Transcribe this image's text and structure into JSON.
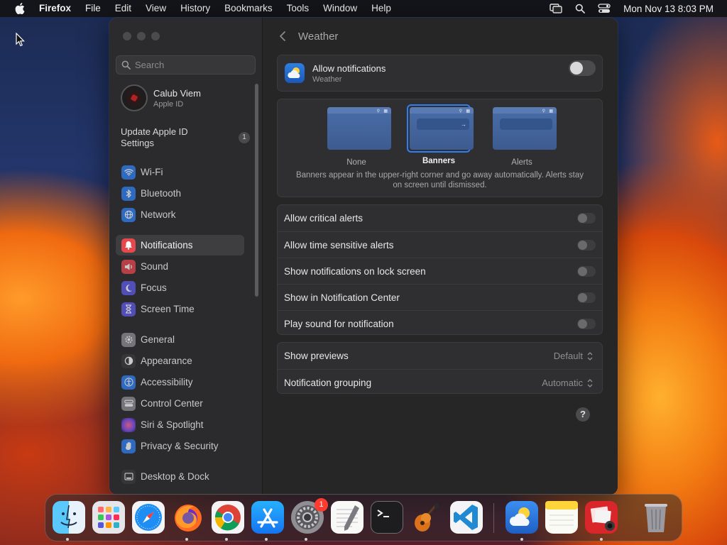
{
  "menubar": {
    "app_name": "Firefox",
    "menus": [
      "File",
      "Edit",
      "View",
      "History",
      "Bookmarks",
      "Tools",
      "Window",
      "Help"
    ],
    "clock": "Mon Nov 13  8:03 PM",
    "status_icons": [
      "screen-mirroring-icon",
      "spotlight-search-icon",
      "control-center-icon"
    ]
  },
  "sidebar": {
    "search_placeholder": "Search",
    "account": {
      "name": "Calub Viem",
      "subtitle": "Apple ID"
    },
    "update": {
      "label": "Update Apple ID Settings",
      "badge": "1"
    },
    "items": [
      {
        "label": "Wi-Fi",
        "icon": "wifi-icon",
        "color": "#2f7ff2"
      },
      {
        "label": "Bluetooth",
        "icon": "bluetooth-icon",
        "color": "#2f7ff2"
      },
      {
        "label": "Network",
        "icon": "globe-icon",
        "color": "#2f7ff2"
      },
      {
        "label": "Notifications",
        "icon": "bell-icon",
        "color": "#e5484d",
        "selected": true
      },
      {
        "label": "Sound",
        "icon": "speaker-icon",
        "color": "#e5484d"
      },
      {
        "label": "Focus",
        "icon": "moon-icon",
        "color": "#5e5ce6"
      },
      {
        "label": "Screen Time",
        "icon": "hourglass-icon",
        "color": "#5e5ce6"
      },
      {
        "label": "General",
        "icon": "gear-icon",
        "color": "#8e8e93"
      },
      {
        "label": "Appearance",
        "icon": "appearance-icon",
        "color": "#3a3a3c"
      },
      {
        "label": "Accessibility",
        "icon": "accessibility-icon",
        "color": "#2f7ff2"
      },
      {
        "label": "Control Center",
        "icon": "control-center-icon",
        "color": "#8e8e93"
      },
      {
        "label": "Siri & Spotlight",
        "icon": "siri-icon",
        "color": "#bf5af2"
      },
      {
        "label": "Privacy & Security",
        "icon": "hand-icon",
        "color": "#2f7ff2"
      },
      {
        "label": "Desktop & Dock",
        "icon": "dock-icon",
        "color": "#3a3a3c"
      }
    ]
  },
  "content": {
    "title": "Weather",
    "allow": {
      "label": "Allow notifications",
      "app": "Weather",
      "enabled": false
    },
    "styles": {
      "options": [
        {
          "label": "None",
          "selected": false
        },
        {
          "label": "Banners",
          "selected": true
        },
        {
          "label": "Alerts",
          "selected": false
        }
      ],
      "description": "Banners appear in the upper-right corner and go away automatically. Alerts stay on screen until dismissed."
    },
    "toggles": [
      {
        "label": "Allow critical alerts",
        "enabled": false
      },
      {
        "label": "Allow time sensitive alerts",
        "enabled": false
      },
      {
        "label": "Show notifications on lock screen",
        "enabled": false
      },
      {
        "label": "Show in Notification Center",
        "enabled": false
      },
      {
        "label": "Play sound for notification",
        "enabled": false
      }
    ],
    "selects": [
      {
        "label": "Show previews",
        "value": "Default"
      },
      {
        "label": "Notification grouping",
        "value": "Automatic"
      }
    ],
    "help": "?"
  },
  "dock": {
    "apps": [
      {
        "name": "Finder",
        "icon": "finder-icon",
        "running": true
      },
      {
        "name": "Launchpad",
        "icon": "launchpad-icon",
        "running": false
      },
      {
        "name": "Safari",
        "icon": "safari-icon",
        "running": false
      },
      {
        "name": "Firefox",
        "icon": "firefox-icon",
        "running": true
      },
      {
        "name": "Chrome",
        "icon": "chrome-icon",
        "running": true
      },
      {
        "name": "App Store",
        "icon": "app-store-icon",
        "running": true
      },
      {
        "name": "System Settings",
        "icon": "system-settings-icon",
        "running": true,
        "badge": "1"
      },
      {
        "name": "TextEdit",
        "icon": "textedit-icon",
        "running": false
      },
      {
        "name": "Terminal",
        "icon": "terminal-icon",
        "running": false
      },
      {
        "name": "GarageBand",
        "icon": "garageband-icon",
        "running": false
      },
      {
        "name": "Visual Studio Code",
        "icon": "vscode-icon",
        "running": false
      },
      {
        "name": "Weather",
        "icon": "weather-icon",
        "running": true
      },
      {
        "name": "Notes",
        "icon": "notes-icon",
        "running": false
      },
      {
        "name": "Photo Booth",
        "icon": "photo-booth-icon",
        "running": true
      },
      {
        "name": "Trash",
        "icon": "trash-icon",
        "running": false
      }
    ]
  }
}
